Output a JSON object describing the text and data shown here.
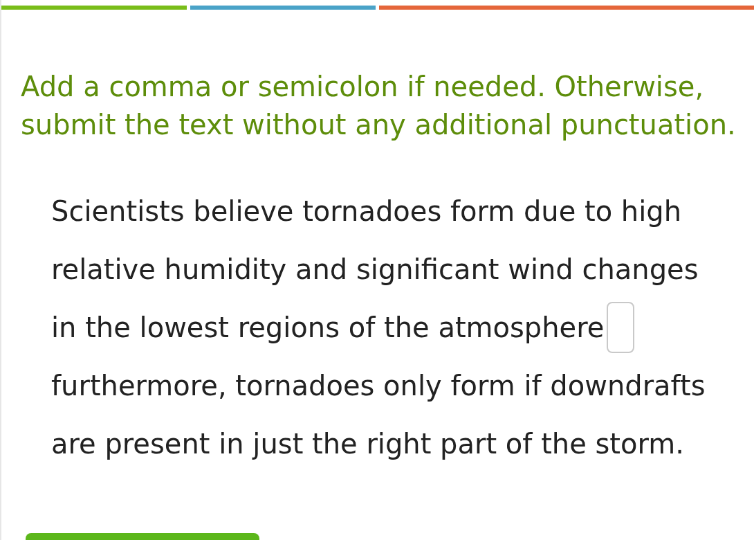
{
  "progress_segments": [
    {
      "color": "#79bd1a"
    },
    {
      "color": "#4aa3c8"
    },
    {
      "color": "#e5663a"
    }
  ],
  "instruction": "Add a comma or semicolon if needed. Otherwise, submit the text without any additional punctuation.",
  "passage_lines": [
    {
      "kind": "text",
      "text": "Scientists believe tornadoes form due to high"
    },
    {
      "kind": "text",
      "text": "relative humidity and significant wind changes"
    },
    {
      "kind": "blank",
      "text": "in the lowest regions of the atmosphere"
    },
    {
      "kind": "text",
      "text": "furthermore, tornadoes only form if downdrafts"
    },
    {
      "kind": "text",
      "text": "are present in just the right part of the storm."
    }
  ]
}
